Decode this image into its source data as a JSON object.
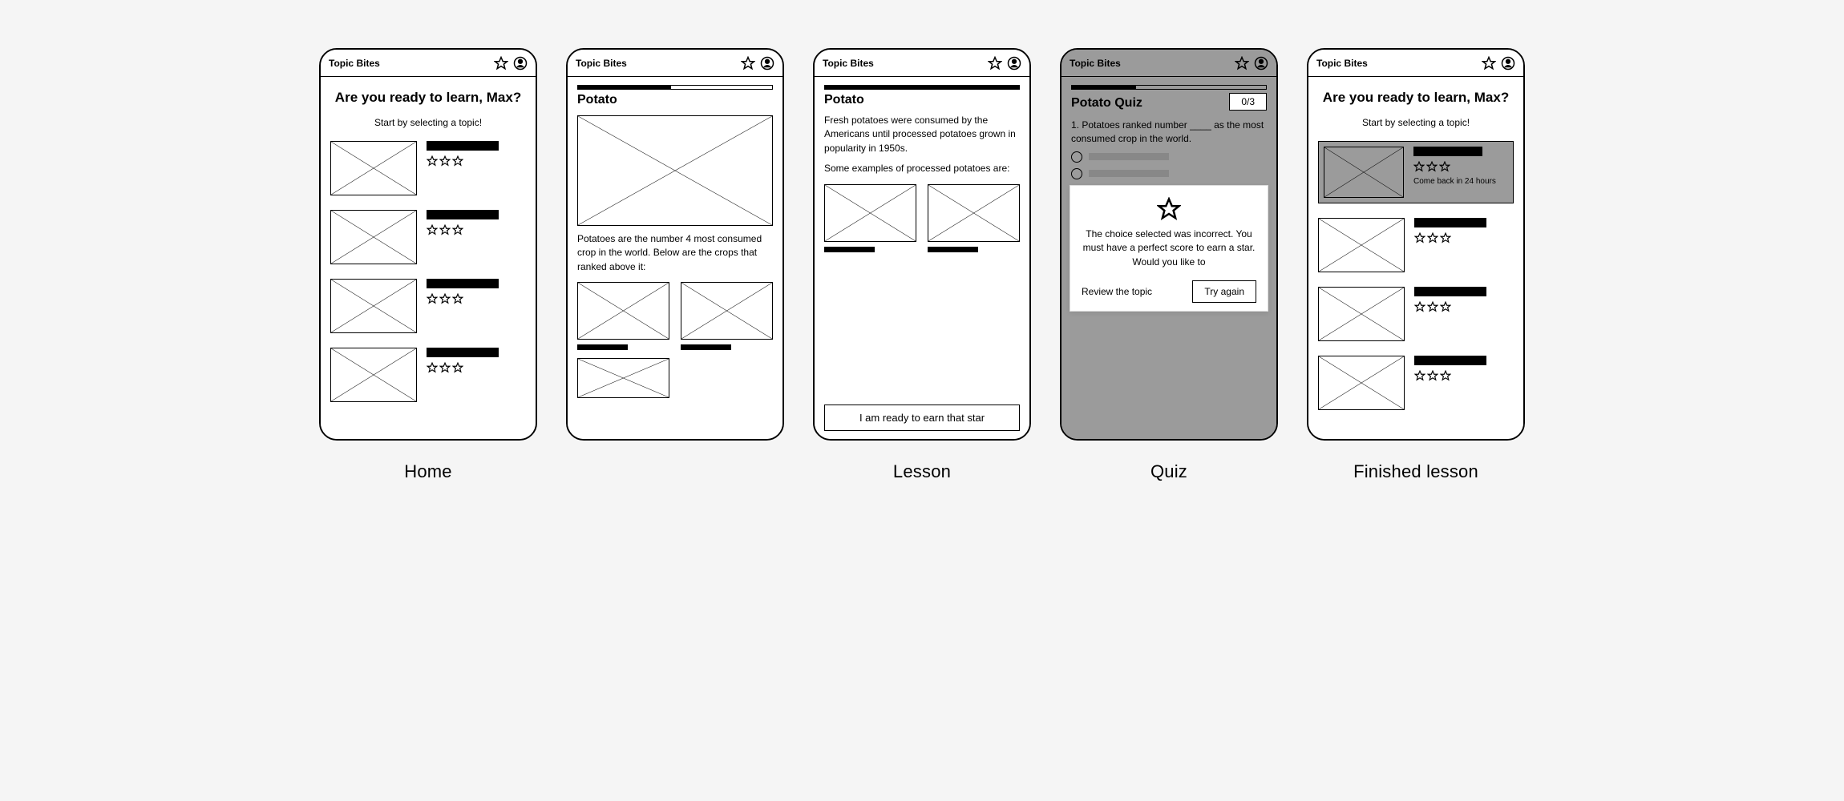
{
  "app_brand": "Topic Bites",
  "labels": {
    "home": "Home",
    "lesson": "Lesson",
    "quiz": "Quiz",
    "finished": "Finished lesson"
  },
  "home": {
    "heading": "Are you ready to learn, Max?",
    "subheading": "Start by selecting a topic!"
  },
  "lesson1": {
    "title": "Potato",
    "progress_percent": 48,
    "paragraph": "Potatoes are the number 4 most consumed crop in the world. Below are the crops that ranked above it:"
  },
  "lesson2": {
    "title": "Potato",
    "para1": "Fresh potatoes were consumed by the Americans until processed potatoes grown in popularity in 1950s.",
    "para2": "Some examples of processed potatoes are:",
    "cta": "I am ready to earn that star"
  },
  "quiz": {
    "title": "Potato Quiz",
    "score": "0/3",
    "progress_percent": 33,
    "question": "1. Potatoes ranked number ____ as the most consumed crop in the world.",
    "modal": {
      "message": "The choice selected was incorrect. You must have a perfect score to earn a star. Would you like to",
      "review": "Review the topic",
      "try_again": "Try again"
    }
  },
  "finished": {
    "heading": "Are you ready to learn, Max?",
    "subheading": "Start by selecting a topic!",
    "locked_note": "Come back in 24 hours"
  }
}
